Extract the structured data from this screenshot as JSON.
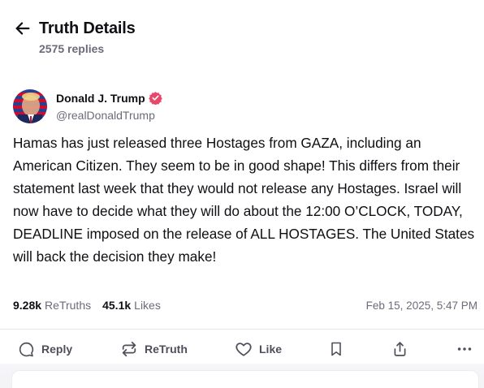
{
  "header": {
    "title": "Truth Details",
    "reply_count": "2575 replies"
  },
  "author": {
    "name": "Donald J. Trump",
    "handle": "@realDonaldTrump",
    "verified": true
  },
  "post": {
    "text": "Hamas has just released three Hostages from GAZA, including an American Citizen. They seem to be in good shape! This differs from their statement last week that they would not release any Hostages. Israel will now have to decide what they will do about the 12:00 O’CLOCK, TODAY, DEADLINE imposed on the release of ALL HOSTAGES. The United States will back the decision they make!"
  },
  "stats": {
    "retruths_count": "9.28k",
    "retruths_label": "ReTruths",
    "likes_count": "45.1k",
    "likes_label": "Likes",
    "timestamp": "Feb 15, 2025, 5:47 PM"
  },
  "actions": {
    "reply": "Reply",
    "retruth": "ReTruth",
    "like": "Like"
  },
  "icons": {
    "back": "arrow-left-icon",
    "verified": "verified-badge-icon",
    "reply": "reply-bubble-icon",
    "retruth": "retruth-icon",
    "like": "heart-icon",
    "bookmark": "bookmark-icon",
    "share": "share-icon",
    "more": "more-dots-icon"
  },
  "colors": {
    "verified": "#e8476a",
    "text": "#0f0f14",
    "muted": "#6b6b7b"
  }
}
